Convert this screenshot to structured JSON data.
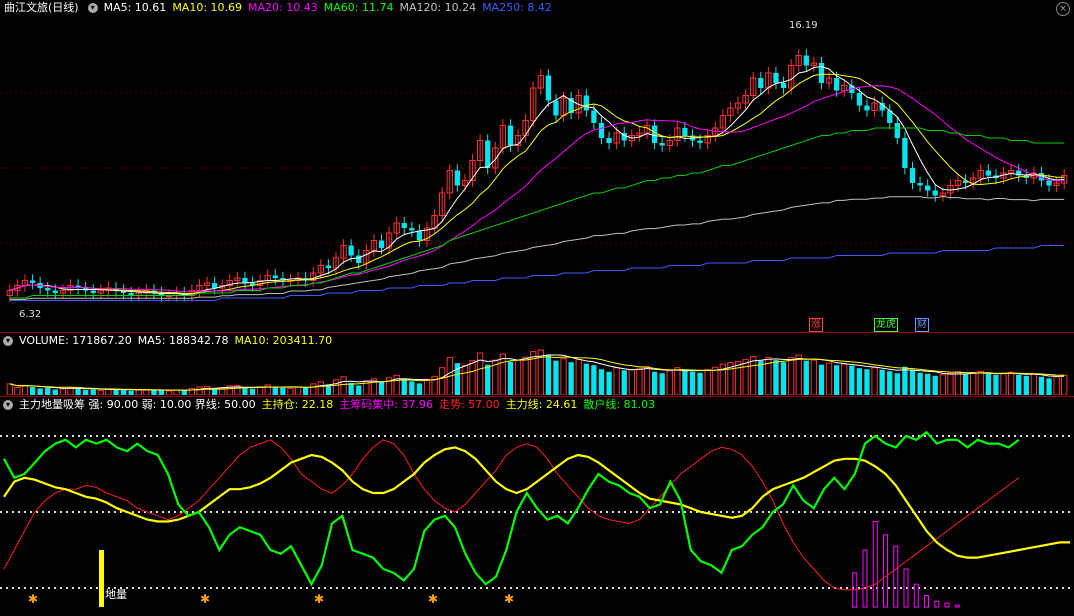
{
  "main": {
    "symbol": "曲江文旅(日线)",
    "ma_labels": [
      {
        "text": "MA5: 10.61",
        "color": "#ffffff"
      },
      {
        "text": "MA10: 10.69",
        "color": "#ffff00"
      },
      {
        "text": "MA20: 10.43",
        "color": "#ff00ff"
      },
      {
        "text": "MA60: 11.74",
        "color": "#00ff00"
      },
      {
        "text": "MA120: 10.24",
        "color": "#c0c0c0"
      },
      {
        "text": "MA250: 8.42",
        "color": "#3b5bff"
      }
    ],
    "high_label": "16.19",
    "low_label": "6.32",
    "event_tags": [
      {
        "text": "涨",
        "color": "#ff4040"
      },
      {
        "text": "龙虎",
        "color": "#40ff40"
      },
      {
        "text": "财",
        "color": "#6699ff"
      }
    ]
  },
  "volume": {
    "labels": [
      {
        "text": "VOLUME: 171867.20",
        "color": "#ffffff"
      },
      {
        "text": "MA5: 188342.78",
        "color": "#ffffff"
      },
      {
        "text": "MA10: 203411.70",
        "color": "#ffff00"
      }
    ]
  },
  "indicator": {
    "labels": [
      {
        "text": "主力地量吸筹 强: 90.00 弱: 10.00 界线: 50.00",
        "color": "#ffffff"
      },
      {
        "text": "主持仓: 22.18",
        "color": "#ffff00"
      },
      {
        "text": "主筹码集中: 37.96",
        "color": "#ff00ff"
      },
      {
        "text": "走势: 57.00",
        "color": "#ff2020"
      },
      {
        "text": "主力线: 24.61",
        "color": "#ffff00"
      },
      {
        "text": "散户线: 81.03",
        "color": "#00ff00"
      }
    ],
    "marker_text": "地量"
  },
  "chart_data": [
    {
      "type": "candlestick",
      "title": "曲江文旅(日线)",
      "annotations": [
        "16.19",
        "6.32"
      ],
      "ylim": [
        5.5,
        17.5
      ],
      "closes": [
        6.6,
        6.8,
        7.0,
        6.9,
        6.7,
        6.6,
        6.5,
        6.6,
        6.8,
        6.7,
        6.6,
        6.5,
        6.6,
        6.7,
        6.6,
        6.5,
        6.4,
        6.5,
        6.6,
        6.5,
        6.4,
        6.4,
        6.5,
        6.4,
        6.6,
        6.8,
        6.9,
        6.7,
        6.8,
        7.0,
        7.1,
        6.9,
        6.8,
        7.0,
        7.2,
        7.1,
        7.0,
        7.0,
        7.1,
        7.0,
        7.3,
        7.6,
        7.5,
        7.9,
        8.4,
        8.0,
        7.7,
        8.2,
        8.6,
        8.3,
        8.9,
        9.3,
        9.1,
        9.0,
        8.6,
        9.1,
        9.6,
        10.5,
        11.4,
        10.8,
        11.0,
        11.8,
        12.6,
        11.5,
        12.3,
        13.2,
        12.4,
        12.8,
        13.4,
        14.7,
        15.2,
        14.2,
        13.6,
        14.3,
        13.7,
        14.4,
        13.8,
        13.3,
        12.7,
        12.5,
        12.9,
        12.6,
        12.8,
        12.9,
        13.2,
        12.5,
        12.4,
        12.6,
        13.1,
        12.8,
        12.6,
        12.5,
        12.8,
        13.1,
        13.6,
        13.9,
        14.1,
        14.4,
        15.1,
        14.7,
        15.3,
        14.9,
        14.7,
        15.6,
        16.0,
        15.6,
        15.7,
        14.9,
        15.1,
        14.6,
        14.8,
        14.5,
        14.0,
        13.8,
        14.1,
        13.8,
        13.3,
        12.7,
        11.5,
        10.9,
        10.8,
        10.6,
        10.4,
        10.5,
        10.8,
        11.0,
        10.9,
        11.1,
        11.4,
        11.2,
        11.1,
        11.3,
        11.4,
        11.2,
        11.1,
        11.3,
        11.0,
        10.8,
        10.9,
        11.2
      ],
      "opens": [
        6.4,
        6.6,
        6.8,
        7.0,
        6.9,
        6.7,
        6.6,
        6.5,
        6.6,
        6.8,
        6.7,
        6.6,
        6.5,
        6.6,
        6.7,
        6.6,
        6.5,
        6.4,
        6.5,
        6.6,
        6.5,
        6.4,
        6.4,
        6.5,
        6.4,
        6.6,
        6.8,
        6.9,
        6.7,
        6.8,
        7.0,
        7.1,
        6.9,
        6.8,
        7.0,
        7.2,
        7.1,
        7.0,
        7.0,
        7.1,
        7.0,
        7.3,
        7.6,
        7.5,
        7.9,
        8.4,
        8.0,
        7.7,
        8.2,
        8.6,
        8.3,
        8.9,
        9.3,
        9.1,
        9.0,
        8.6,
        9.1,
        9.6,
        10.5,
        11.4,
        10.8,
        11.0,
        11.8,
        12.6,
        11.5,
        12.3,
        13.2,
        12.4,
        12.8,
        13.4,
        14.7,
        15.2,
        14.2,
        13.6,
        14.3,
        13.7,
        14.4,
        13.8,
        13.3,
        12.7,
        12.5,
        12.9,
        12.6,
        12.8,
        12.9,
        13.2,
        12.5,
        12.4,
        12.6,
        13.1,
        12.8,
        12.6,
        12.5,
        12.8,
        13.1,
        13.6,
        13.9,
        14.1,
        14.4,
        15.1,
        14.7,
        15.3,
        14.9,
        14.7,
        15.6,
        16.0,
        15.6,
        15.7,
        14.9,
        15.1,
        14.6,
        14.8,
        14.5,
        14.0,
        13.8,
        14.1,
        13.8,
        13.3,
        12.7,
        11.5,
        10.9,
        10.8,
        10.6,
        10.4,
        10.5,
        10.8,
        11.0,
        10.9,
        11.1,
        11.4,
        11.2,
        11.1,
        11.3,
        11.4,
        11.2,
        11.1,
        11.3,
        11.0,
        10.8,
        10.9
      ],
      "ma250": [
        6.2,
        6.2,
        6.2,
        6.2,
        6.2,
        6.2,
        6.2,
        6.2,
        6.2,
        6.2,
        6.2,
        6.2,
        6.2,
        6.2,
        6.2,
        6.2,
        6.2,
        6.2,
        6.2,
        6.2,
        6.2,
        6.2,
        6.2,
        6.2,
        6.2,
        6.2,
        6.2,
        6.2,
        6.3,
        6.3,
        6.3,
        6.3,
        6.3,
        6.3,
        6.3,
        6.3,
        6.3,
        6.4,
        6.4,
        6.4,
        6.4,
        6.4,
        6.5,
        6.5,
        6.5,
        6.5,
        6.6,
        6.6,
        6.6,
        6.6,
        6.7,
        6.7,
        6.7,
        6.7,
        6.8,
        6.8,
        6.8,
        6.8,
        6.9,
        6.9,
        6.9,
        7.0,
        7.0,
        7.0,
        7.0,
        7.1,
        7.1,
        7.1,
        7.1,
        7.2,
        7.2,
        7.2,
        7.2,
        7.3,
        7.3,
        7.3,
        7.3,
        7.4,
        7.4,
        7.4,
        7.4,
        7.4,
        7.5,
        7.5,
        7.5,
        7.5,
        7.5,
        7.6,
        7.6,
        7.6,
        7.6,
        7.6,
        7.7,
        7.7,
        7.7,
        7.7,
        7.7,
        7.7,
        7.8,
        7.8,
        7.8,
        7.8,
        7.8,
        7.9,
        7.9,
        7.9,
        7.9,
        7.9,
        7.9,
        8.0,
        8.0,
        8.0,
        8.0,
        8.0,
        8.0,
        8.0,
        8.1,
        8.1,
        8.1,
        8.1,
        8.1,
        8.1,
        8.1,
        8.2,
        8.2,
        8.2,
        8.2,
        8.2,
        8.2,
        8.2,
        8.3,
        8.3,
        8.3,
        8.3,
        8.3,
        8.3,
        8.4,
        8.4,
        8.4,
        8.4
      ],
      "ma60": [
        6.3,
        6.3,
        6.3,
        6.4,
        6.4,
        6.4,
        6.4,
        6.4,
        6.4,
        6.4,
        6.4,
        6.4,
        6.4,
        6.4,
        6.4,
        6.4,
        6.4,
        6.4,
        6.4,
        6.4,
        6.4,
        6.4,
        6.4,
        6.4,
        6.4,
        6.5,
        6.5,
        6.5,
        6.5,
        6.5,
        6.6,
        6.6,
        6.6,
        6.6,
        6.7,
        6.7,
        6.7,
        6.8,
        6.8,
        6.8,
        6.9,
        6.9,
        7.0,
        7.1,
        7.2,
        7.3,
        7.3,
        7.4,
        7.5,
        7.6,
        7.7,
        7.8,
        7.9,
        8.0,
        8.1,
        8.2,
        8.3,
        8.4,
        8.6,
        8.7,
        8.8,
        8.9,
        9.0,
        9.1,
        9.2,
        9.3,
        9.4,
        9.5,
        9.6,
        9.7,
        9.8,
        9.9,
        10.0,
        10.1,
        10.2,
        10.3,
        10.4,
        10.5,
        10.5,
        10.6,
        10.7,
        10.7,
        10.8,
        10.9,
        11.0,
        11.0,
        11.1,
        11.1,
        11.2,
        11.2,
        11.3,
        11.3,
        11.4,
        11.5,
        11.6,
        11.6,
        11.7,
        11.8,
        11.9,
        12.0,
        12.1,
        12.2,
        12.3,
        12.4,
        12.5,
        12.6,
        12.7,
        12.8,
        12.8,
        12.9,
        12.9,
        13.0,
        13.0,
        13.0,
        13.1,
        13.1,
        13.1,
        13.1,
        13.1,
        13.1,
        13.1,
        13.0,
        13.0,
        13.0,
        12.9,
        12.9,
        12.8,
        12.8,
        12.8,
        12.7,
        12.7,
        12.7,
        12.6,
        12.6,
        12.6,
        12.5,
        12.5,
        12.5,
        12.5,
        12.5
      ]
    },
    {
      "type": "bar",
      "title": "VOLUME",
      "values": [
        2.2,
        1.5,
        1.9,
        1.6,
        1.3,
        1.4,
        1.1,
        1.2,
        1.5,
        1.3,
        1.0,
        1.1,
        0.9,
        1.2,
        1.1,
        1.0,
        0.8,
        1.0,
        1.1,
        1.0,
        0.9,
        0.8,
        1.0,
        0.9,
        1.3,
        1.6,
        1.7,
        1.2,
        1.4,
        1.8,
        1.9,
        1.3,
        1.2,
        1.6,
        2.0,
        1.7,
        1.4,
        1.3,
        1.6,
        1.4,
        2.2,
        2.6,
        2.1,
        3.0,
        3.6,
        2.4,
        1.9,
        2.8,
        3.2,
        2.6,
        3.4,
        3.9,
        3.0,
        2.7,
        2.3,
        3.1,
        3.7,
        5.4,
        7.4,
        6.3,
        5.8,
        6.8,
        8.3,
        6.0,
        6.9,
        8.1,
        6.6,
        6.9,
        7.5,
        8.6,
        8.9,
        7.8,
        6.8,
        7.2,
        6.5,
        7.0,
        6.2,
        5.9,
        5.1,
        4.6,
        5.4,
        4.9,
        5.0,
        5.3,
        5.6,
        4.6,
        4.3,
        4.8,
        5.4,
        4.9,
        4.6,
        4.4,
        5.0,
        5.5,
        6.1,
        6.4,
        6.6,
        7.0,
        7.6,
        6.8,
        7.4,
        6.9,
        6.5,
        7.4,
        7.9,
        6.8,
        6.9,
        6.0,
        6.3,
        5.9,
        6.1,
        5.8,
        5.3,
        5.1,
        5.4,
        5.0,
        4.7,
        4.3,
        5.6,
        5.0,
        4.4,
        4.2,
        3.8,
        4.0,
        4.3,
        4.6,
        4.1,
        4.4,
        4.7,
        4.2,
        4.0,
        4.3,
        4.5,
        4.0,
        3.8,
        4.1,
        3.6,
        3.3,
        3.6,
        3.9
      ]
    },
    {
      "type": "line",
      "title": "主力地量吸筹",
      "ylim": [
        0,
        100
      ],
      "series": [
        {
          "name": "主力线",
          "color": "#ffff00",
          "values": [
            58,
            66,
            68,
            67,
            65,
            63,
            62,
            60,
            58,
            57,
            55,
            52,
            50,
            48,
            46,
            45,
            45,
            46,
            48,
            50,
            54,
            58,
            62,
            62,
            63,
            65,
            68,
            72,
            76,
            78,
            80,
            79,
            76,
            72,
            66,
            62,
            60,
            60,
            62,
            66,
            70,
            76,
            80,
            83,
            84,
            82,
            78,
            72,
            66,
            62,
            60,
            62,
            66,
            70,
            74,
            78,
            80,
            79,
            76,
            72,
            68,
            64,
            60,
            57,
            56,
            55,
            54,
            52,
            50,
            49,
            48,
            47,
            48,
            52,
            58,
            62,
            64,
            66,
            68,
            71,
            74,
            77,
            78,
            78,
            77,
            74,
            70,
            64,
            56,
            48,
            40,
            34,
            30,
            27,
            26,
            26,
            27,
            28,
            29,
            30,
            31,
            32,
            33,
            34,
            34
          ]
        },
        {
          "name": "散户线",
          "color": "#00ff00",
          "values": [
            78,
            68,
            70,
            76,
            82,
            86,
            88,
            84,
            88,
            86,
            88,
            84,
            82,
            86,
            82,
            80,
            70,
            54,
            48,
            50,
            42,
            30,
            38,
            42,
            40,
            38,
            30,
            28,
            32,
            22,
            12,
            22,
            44,
            48,
            30,
            28,
            26,
            20,
            18,
            14,
            20,
            40,
            46,
            48,
            42,
            28,
            18,
            12,
            16,
            30,
            50,
            60,
            52,
            46,
            48,
            44,
            52,
            62,
            70,
            66,
            64,
            60,
            58,
            52,
            54,
            66,
            56,
            30,
            24,
            22,
            18,
            30,
            32,
            38,
            42,
            50,
            54,
            64,
            56,
            52,
            62,
            68,
            62,
            70,
            86,
            90,
            86,
            84,
            90,
            88,
            92,
            86,
            88,
            88,
            84,
            88,
            86,
            86,
            84,
            88
          ]
        },
        {
          "name": "走势",
          "color": "#ff2020",
          "values": [
            20,
            30,
            40,
            50,
            56,
            60,
            62,
            62,
            64,
            63,
            60,
            58,
            56,
            52,
            50,
            48,
            46,
            48,
            52,
            56,
            62,
            68,
            74,
            80,
            84,
            86,
            88,
            84,
            78,
            70,
            66,
            62,
            60,
            64,
            70,
            78,
            84,
            88,
            86,
            80,
            70,
            62,
            56,
            52,
            50,
            54,
            60,
            66,
            72,
            80,
            84,
            86,
            84,
            78,
            70,
            64,
            58,
            52,
            48,
            46,
            45,
            44,
            46,
            52,
            58,
            64,
            70,
            74,
            78,
            82,
            84,
            83,
            80,
            74,
            66,
            56,
            44,
            34,
            26,
            20,
            14,
            10,
            9,
            9,
            10,
            12,
            16,
            20,
            24,
            28,
            32,
            36,
            40,
            44,
            48,
            52,
            56,
            60,
            64,
            68
          ]
        },
        {
          "name": "主筹码集中",
          "color": "#ff00ff",
          "values": [
            0,
            0,
            0,
            0,
            0,
            0,
            0,
            0,
            0,
            0,
            0,
            0,
            0,
            0,
            0,
            0,
            0,
            0,
            0,
            0,
            0,
            0,
            0,
            0,
            0,
            0,
            0,
            0,
            0,
            0,
            0,
            0,
            0,
            0,
            0,
            0,
            0,
            0,
            0,
            0,
            0,
            0,
            0,
            0,
            0,
            0,
            0,
            0,
            0,
            0,
            0,
            0,
            0,
            0,
            0,
            0,
            0,
            0,
            0,
            0,
            0,
            0,
            0,
            0,
            0,
            0,
            0,
            0,
            0,
            0,
            0,
            0,
            0,
            0,
            0,
            0,
            0,
            0,
            0,
            0,
            0,
            0,
            0,
            18,
            30,
            45,
            38,
            32,
            20,
            12,
            6,
            3,
            2,
            1,
            0,
            0,
            0,
            0,
            0,
            0
          ]
        }
      ],
      "reference_lines": [
        90,
        50,
        10
      ]
    }
  ]
}
